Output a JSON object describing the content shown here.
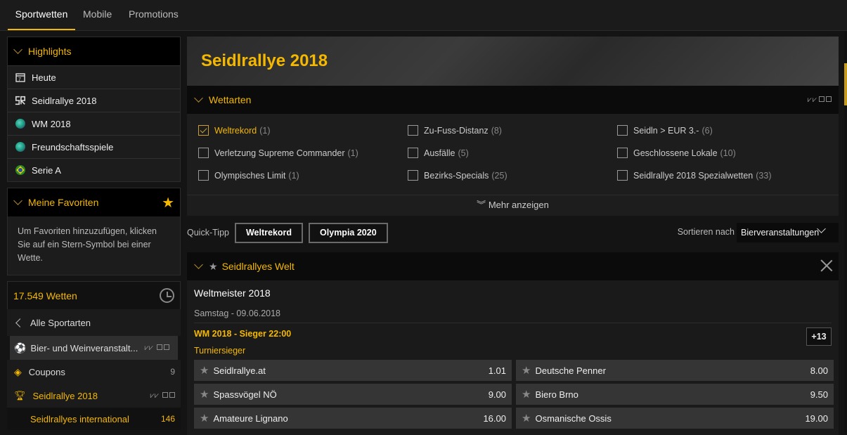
{
  "topnav": {
    "tabs": [
      "Sportwetten",
      "Mobile",
      "Promotions"
    ]
  },
  "highlights": {
    "title": "Highlights",
    "items": [
      {
        "label": "Heute",
        "icon": "calendar-icon"
      },
      {
        "label": "Seidlrallye 2018",
        "icon": "sr-logo-icon"
      },
      {
        "label": "WM 2018",
        "icon": "globe-icon"
      },
      {
        "label": "Freundschaftsspiele",
        "icon": "globe-icon"
      },
      {
        "label": "Serie A",
        "icon": "brazil-flag-icon"
      }
    ]
  },
  "favorites": {
    "title": "Meine Favoriten",
    "text": "Um Favoriten hinzuzufügen, klicken Sie auf ein Stern-Symbol bei einer Wette."
  },
  "sports": {
    "count_label": "17.549 Wetten",
    "back_label": "Alle Sportarten",
    "rows": [
      {
        "label": "Bier- und Weinveranstalt...",
        "count": ""
      },
      {
        "label": "Coupons",
        "count": "9"
      },
      {
        "label": "Seidlrallye 2018",
        "count": ""
      },
      {
        "label": "Seidlrallyes international",
        "count": "146"
      }
    ]
  },
  "hero": {
    "title": "Seidlrallye 2018"
  },
  "wettarten": {
    "title": "Wettarten",
    "items": [
      {
        "label": "Weltrekord",
        "count": "(1)",
        "checked": true
      },
      {
        "label": "Zu-Fuss-Distanz",
        "count": "(8)"
      },
      {
        "label": "Seidln > EUR 3.-",
        "count": "(6)"
      },
      {
        "label": "Verletzung Supreme Commander",
        "count": "(1)"
      },
      {
        "label": "Ausfälle",
        "count": "(5)"
      },
      {
        "label": "Geschlossene Lokale",
        "count": "(10)"
      },
      {
        "label": "Olympisches Limit",
        "count": "(1)"
      },
      {
        "label": "Bezirks-Specials",
        "count": "(25)"
      },
      {
        "label": "Seidlrallye 2018 Spezialwetten",
        "count": "(33)"
      }
    ],
    "more_label": "Mehr anzeigen"
  },
  "quick": {
    "label": "Quick-Tipp",
    "buttons": [
      "Weltrekord",
      "Olympia 2020"
    ],
    "sort_label": "Sortieren nach",
    "sort_value": "Bierveranstaltungen"
  },
  "event": {
    "section_title": "Seidlrallyes Welt",
    "title": "Weltmeister 2018",
    "date": "Samstag - 09.06.2018",
    "market_title": "WM 2018 - Sieger 22:00",
    "more_markets": "+13",
    "market_sub": "Turniersieger",
    "odds": [
      {
        "name": "Seidlrallye.at",
        "value": "1.01"
      },
      {
        "name": "Deutsche Penner",
        "value": "8.00"
      },
      {
        "name": "Spassvögel NÖ",
        "value": "9.00"
      },
      {
        "name": "Biero Brno",
        "value": "9.50"
      },
      {
        "name": "Amateure Lignano",
        "value": "16.00"
      },
      {
        "name": "Osmanische Ossis",
        "value": "19.00"
      }
    ]
  }
}
